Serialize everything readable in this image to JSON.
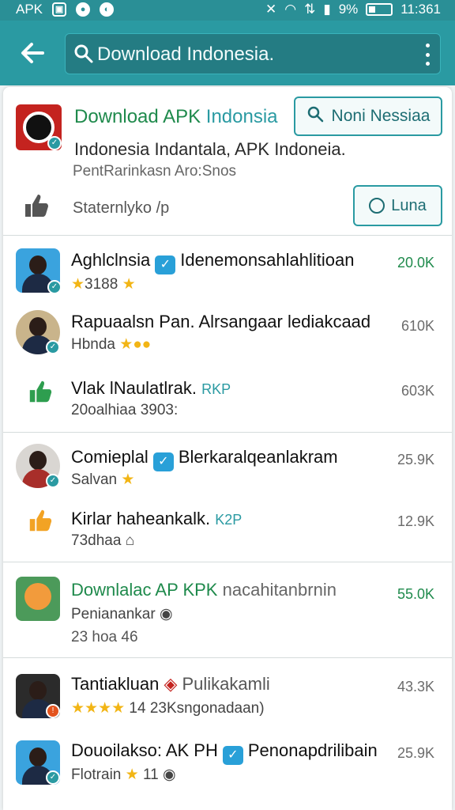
{
  "status_bar": {
    "carrier": "APK",
    "time": "11:361",
    "battery": "9%",
    "icons": [
      "image-icon",
      "circle-icon",
      "shield-icon",
      "mute-icon",
      "wifi-icon",
      "data-icon",
      "signal-icon",
      "battery-icon"
    ]
  },
  "app_bar": {
    "back_icon": "arrow-left-icon",
    "search_text": "Download Indonesia.",
    "menu_icon": "more-vert-icon"
  },
  "hero": {
    "title_part1": "Download APK",
    "title_part2": "Indonsia",
    "subtitle": "Indonesia Indantala, APK Indoneia.",
    "meta": "PentRarinkasn Aro:Snos",
    "action_button": "Noni Nessiaa",
    "like_label": "Staternlyko /p",
    "luna_button": "Luna"
  },
  "items": [
    {
      "title": "Aghlclnsia",
      "title2": "Idenemonsahlahlitioan",
      "sub": "3188",
      "count": "20.0K",
      "count_green": true
    },
    {
      "title": "Rapuaalsn Pan. Alrsangaar lediakcaad",
      "sub": "Hbnda",
      "count": "610K",
      "count_green": false
    },
    {
      "title": "Vlak  lNaulatlrak.",
      "accent": "RKP",
      "sub": "20oalhiaa 3903:",
      "count": "603K",
      "count_green": false
    },
    {
      "title": "Comieplal",
      "title2": "Blerkaralqeanlakram",
      "sub": "Salvan",
      "count": "25.9K",
      "count_green": false
    },
    {
      "title": "Kirlar haheankalk.",
      "accent": "K2P",
      "sub": "73dhaa",
      "count": "12.9K",
      "count_green": false
    },
    {
      "title": "Downlalac AP  KPK",
      "title2": "nacahitanbrnin",
      "sub": "Penianankar",
      "sub2": "23 hoa 46",
      "count": "55.0K",
      "count_green": true
    },
    {
      "title": "Tantiakluan",
      "title2": "Pulikakamli",
      "sub": "14 23Ksngonadaan)",
      "count": "43.3K",
      "count_green": false
    },
    {
      "title": "Douoilakso: AK PH",
      "title2": "Penonapdrilibain",
      "sub": "Flotrain",
      "sub_num": "11",
      "count": "25.9K",
      "count_green": false
    }
  ],
  "colors": {
    "primary": "#2a9aa2",
    "status_bar": "#2a8f96",
    "green": "#1f8a4c",
    "verify_blue": "#29a0d8",
    "star": "#f2b515"
  }
}
